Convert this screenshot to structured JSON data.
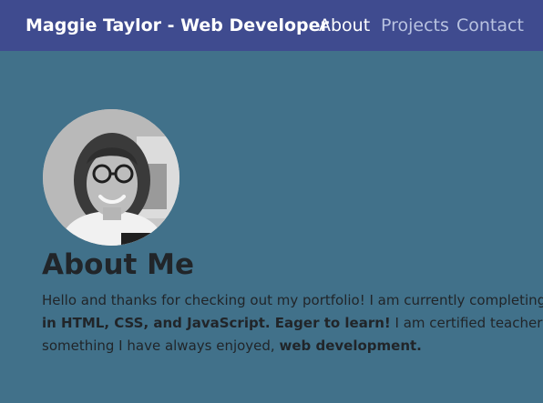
{
  "nav": {
    "brand": "Maggie Taylor - Web Developer",
    "links": [
      {
        "label": "About",
        "active": true
      },
      {
        "label": "Projects",
        "active": false
      },
      {
        "label": "Contact",
        "active": false
      }
    ]
  },
  "about": {
    "heading": "About Me",
    "line1": "Hello and thanks for checking out my portfolio! I am currently completing",
    "line2_bold": "in HTML, CSS, and JavaScript. Eager to learn!",
    "line2_rest": " I am certified teacher and",
    "line3_start": "something I have always enjoyed, ",
    "line3_bold": "web development."
  },
  "icons": {
    "avatar": "profile-photo"
  },
  "colors": {
    "navbar_bg": "#3f4b8f",
    "page_bg": "#41718a",
    "text": "#212529",
    "nav_active": "#ffffff",
    "nav_inactive": "#b8c2e0"
  }
}
